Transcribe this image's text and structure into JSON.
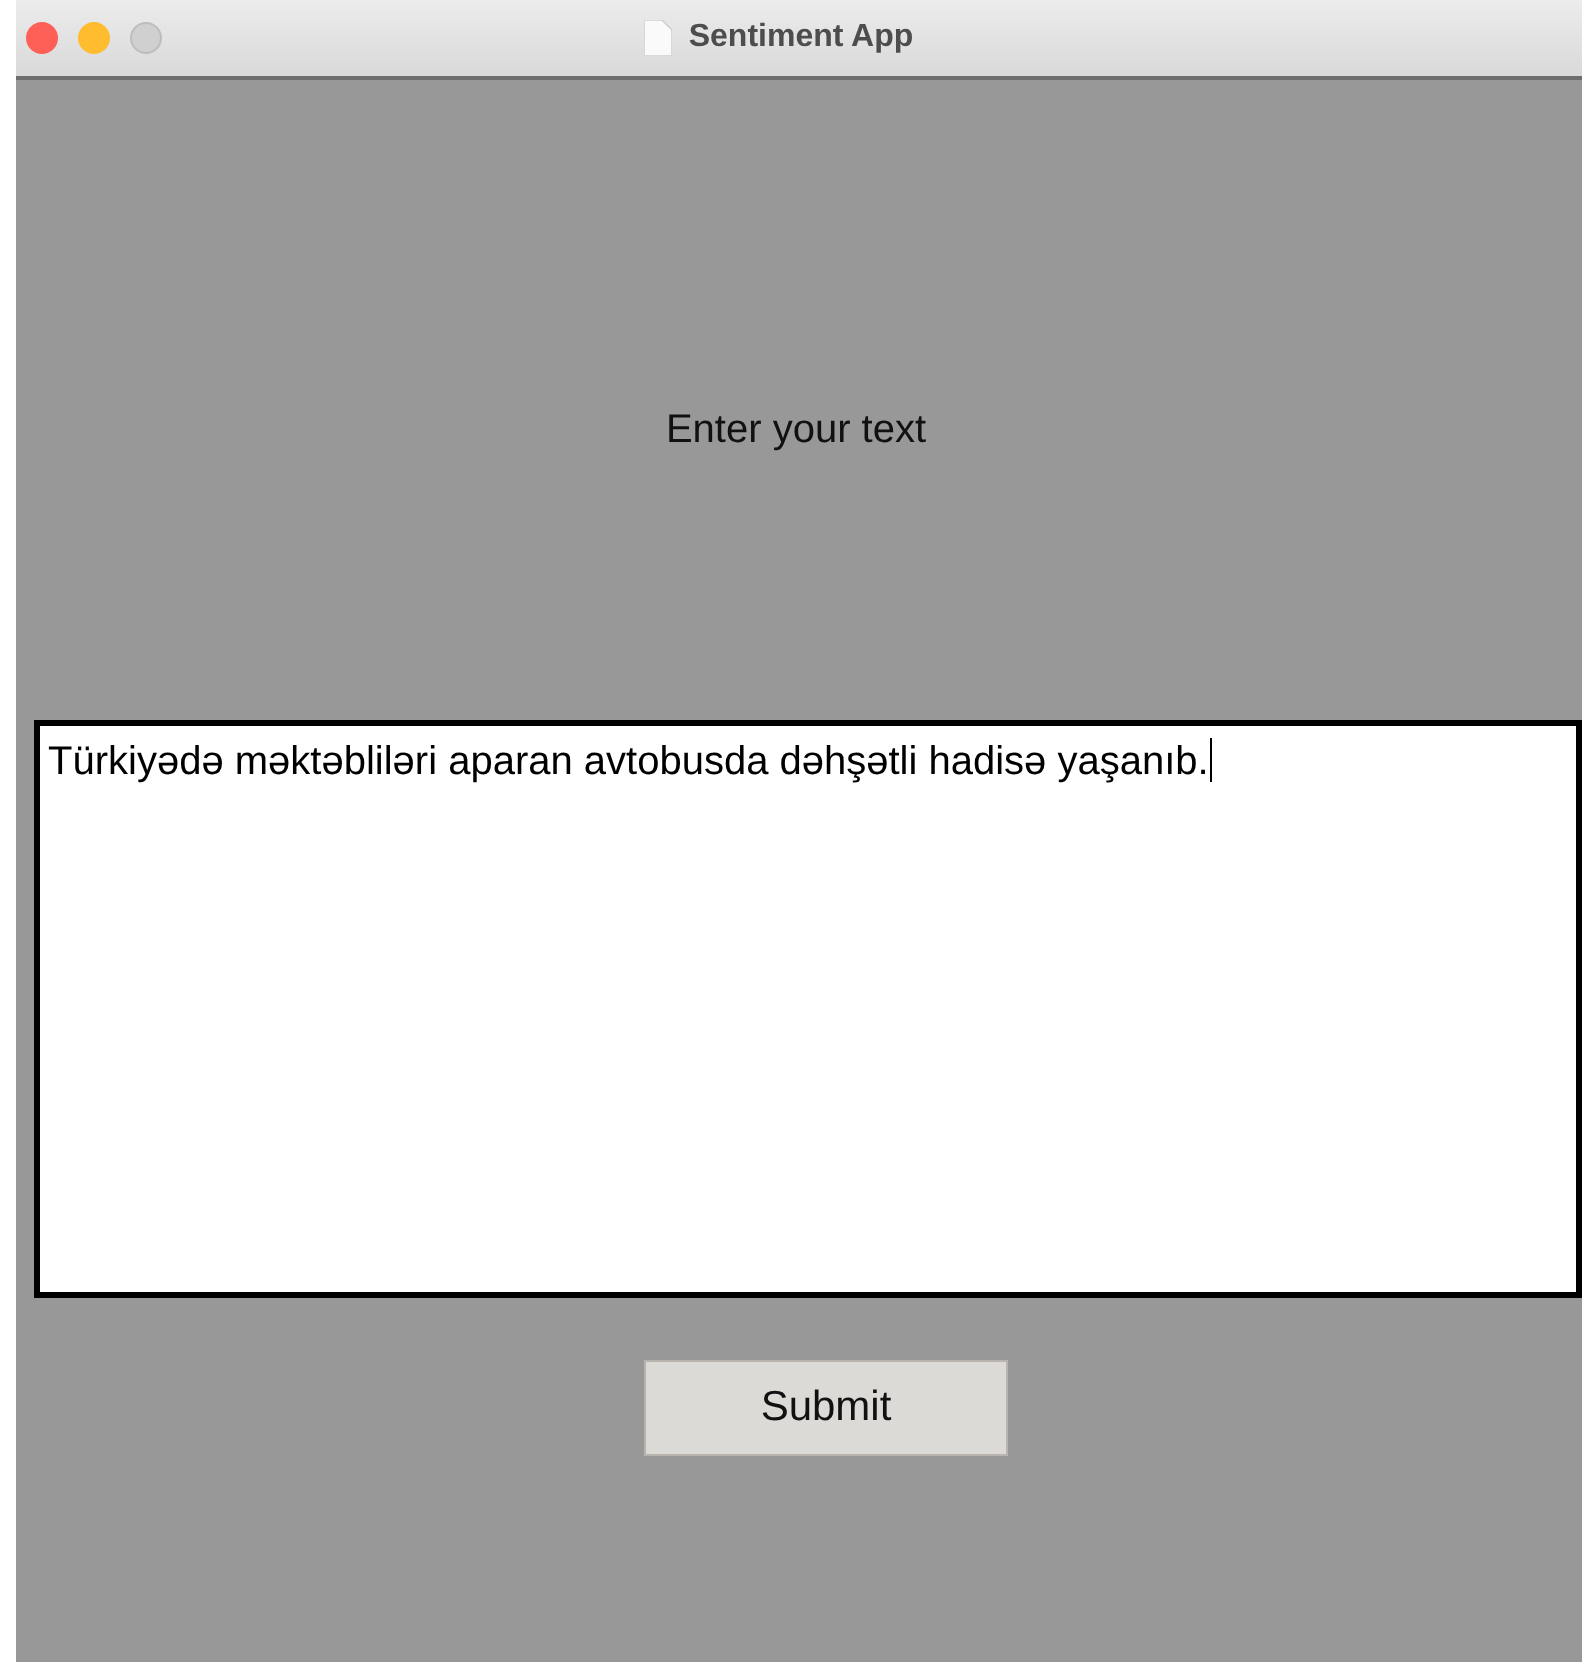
{
  "window": {
    "title": "Sentiment App"
  },
  "prompt": "Enter your text",
  "text_input": {
    "value": "Türkiyədə məktəbliləri aparan avtobusda dəhşətli hadisə yaşanıb."
  },
  "buttons": [
    "Submit"
  ]
}
